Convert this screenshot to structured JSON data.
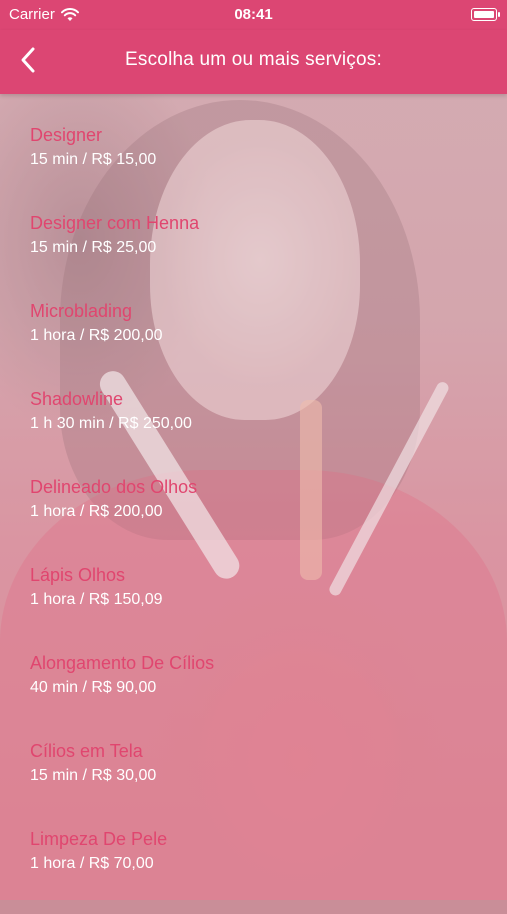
{
  "status_bar": {
    "carrier": "Carrier",
    "time": "08:41"
  },
  "header": {
    "title": "Escolha um ou mais serviços:",
    "back_icon": "chevron-left-icon"
  },
  "colors": {
    "accent": "#dc4673",
    "service_name": "#e0466f",
    "service_info": "#ffffff"
  },
  "services": [
    {
      "name": "Designer",
      "info": "15 min / R$ 15,00"
    },
    {
      "name": "Designer com Henna",
      "info": "15 min / R$ 25,00"
    },
    {
      "name": "Microblading",
      "info": "1 hora / R$ 200,00"
    },
    {
      "name": "Shadowline",
      "info": "1 h 30 min / R$ 250,00"
    },
    {
      "name": "Delineado dos Olhos",
      "info": "1 hora / R$ 200,00"
    },
    {
      "name": "Lápis Olhos",
      "info": "1 hora / R$ 150,09"
    },
    {
      "name": "Alongamento De Cílios",
      "info": "40 min / R$ 90,00"
    },
    {
      "name": "Cílios em Tela",
      "info": "15 min / R$ 30,00"
    },
    {
      "name": "Limpeza De Pele",
      "info": "1 hora / R$ 70,00"
    }
  ]
}
